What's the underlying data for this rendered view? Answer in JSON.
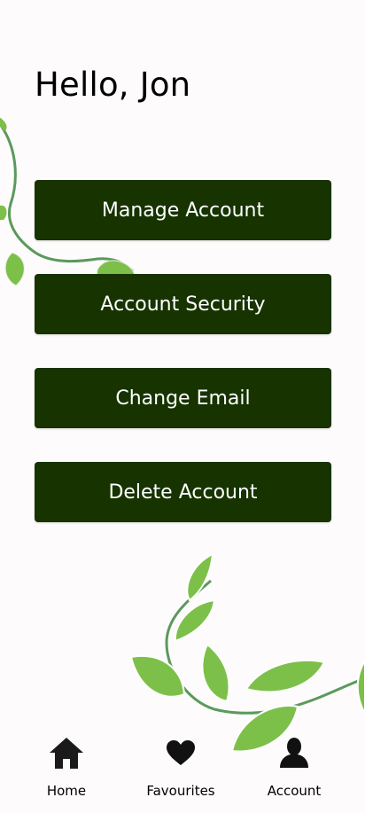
{
  "greeting": "Hello, Jon",
  "menu": {
    "items": [
      {
        "label": "Manage Account"
      },
      {
        "label": "Account Security"
      },
      {
        "label": "Change Email"
      },
      {
        "label": "Delete Account"
      }
    ]
  },
  "nav": {
    "items": [
      {
        "label": "Home",
        "icon": "home-icon"
      },
      {
        "label": "Favourites",
        "icon": "heart-icon"
      },
      {
        "label": "Account",
        "icon": "user-icon"
      }
    ],
    "active": "Account"
  },
  "colors": {
    "button_bg": "#163300",
    "button_text": "#ffffff",
    "leaf": "#7cc04a",
    "stem": "#5a9a5c"
  }
}
